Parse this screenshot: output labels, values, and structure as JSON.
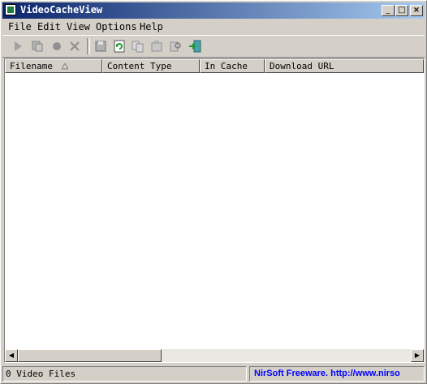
{
  "window": {
    "title": "VideoCacheView"
  },
  "title_buttons": {
    "minimize": "_",
    "maximize": "□",
    "close": "×"
  },
  "menu": [
    {
      "label": "File"
    },
    {
      "label": "Edit"
    },
    {
      "label": "View"
    },
    {
      "label": "Options"
    },
    {
      "label": "Help"
    }
  ],
  "toolbar": {
    "icons": [
      "play-icon",
      "copy-files-icon",
      "record-icon",
      "delete-icon",
      "save-icon",
      "refresh-icon",
      "copy-icon",
      "properties-icon",
      "find-icon",
      "exit-icon"
    ]
  },
  "columns": [
    "Filename",
    "Content Type",
    "In Cache",
    "Download URL"
  ],
  "scroll_arrows": {
    "left": "◀",
    "right": "▶"
  },
  "status": {
    "count": "0 Video Files",
    "link": "NirSoft Freeware.  http://www.nirso",
    "link_color": "#0000ff"
  }
}
